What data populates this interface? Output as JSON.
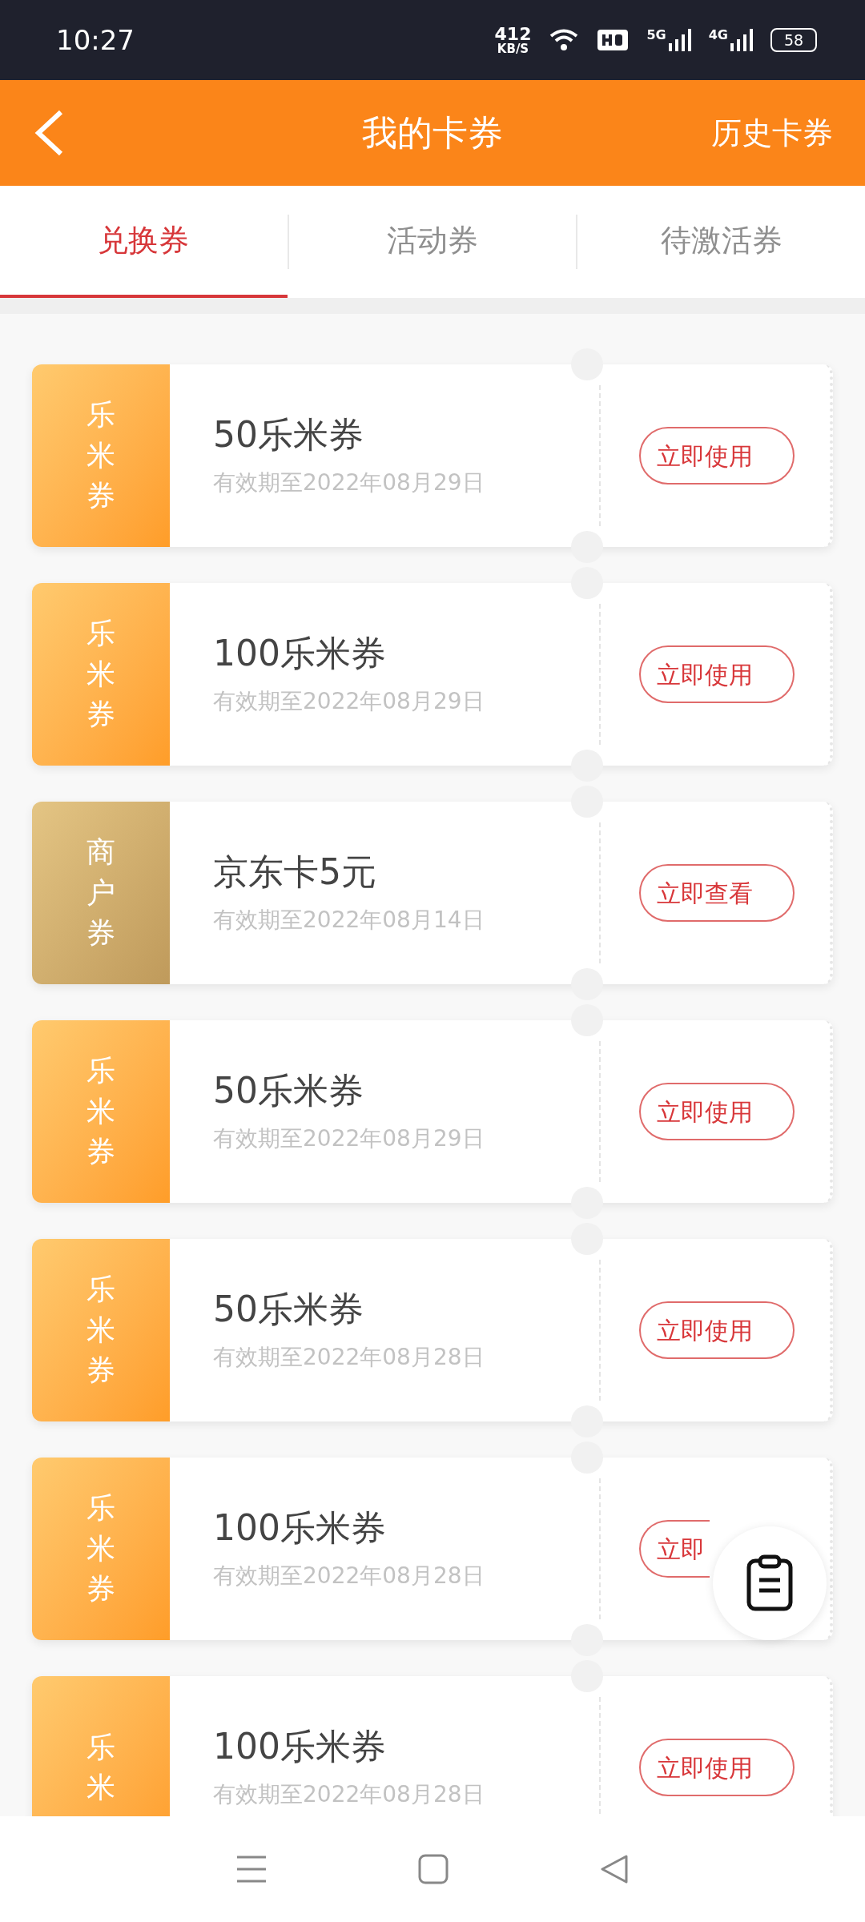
{
  "status_bar": {
    "time": "10:27",
    "speed": "412",
    "speed_unit": "KB/S",
    "networks": [
      "5G",
      "4G"
    ],
    "battery": "58"
  },
  "header": {
    "title": "我的卡券",
    "action": "历史卡券"
  },
  "tabs": [
    {
      "label": "兑换券",
      "selected": true
    },
    {
      "label": "活动券",
      "selected": false
    },
    {
      "label": "待激活券",
      "selected": false
    }
  ],
  "coupons": [
    {
      "kind": "lemi",
      "tag": "乐米券",
      "name": "50乐米券",
      "validity": "有效期至2022年08月29日",
      "button": "立即使用",
      "button_cut": false
    },
    {
      "kind": "lemi",
      "tag": "乐米券",
      "name": "100乐米券",
      "validity": "有效期至2022年08月29日",
      "button": "立即使用",
      "button_cut": false
    },
    {
      "kind": "merchant",
      "tag": "商户券",
      "name": "京东卡5元",
      "validity": "有效期至2022年08月14日",
      "button": "立即查看",
      "button_cut": false
    },
    {
      "kind": "lemi",
      "tag": "乐米券",
      "name": "50乐米券",
      "validity": "有效期至2022年08月29日",
      "button": "立即使用",
      "button_cut": false
    },
    {
      "kind": "lemi",
      "tag": "乐米券",
      "name": "50乐米券",
      "validity": "有效期至2022年08月28日",
      "button": "立即使用",
      "button_cut": false
    },
    {
      "kind": "lemi",
      "tag": "乐米券",
      "name": "100乐米券",
      "validity": "有效期至2022年08月28日",
      "button": "立即",
      "button_cut": true
    },
    {
      "kind": "lemi",
      "tag": "乐米",
      "name": "100乐米券",
      "validity": "有效期至2022年08月28日",
      "button": "立即使用",
      "button_cut": false
    }
  ]
}
